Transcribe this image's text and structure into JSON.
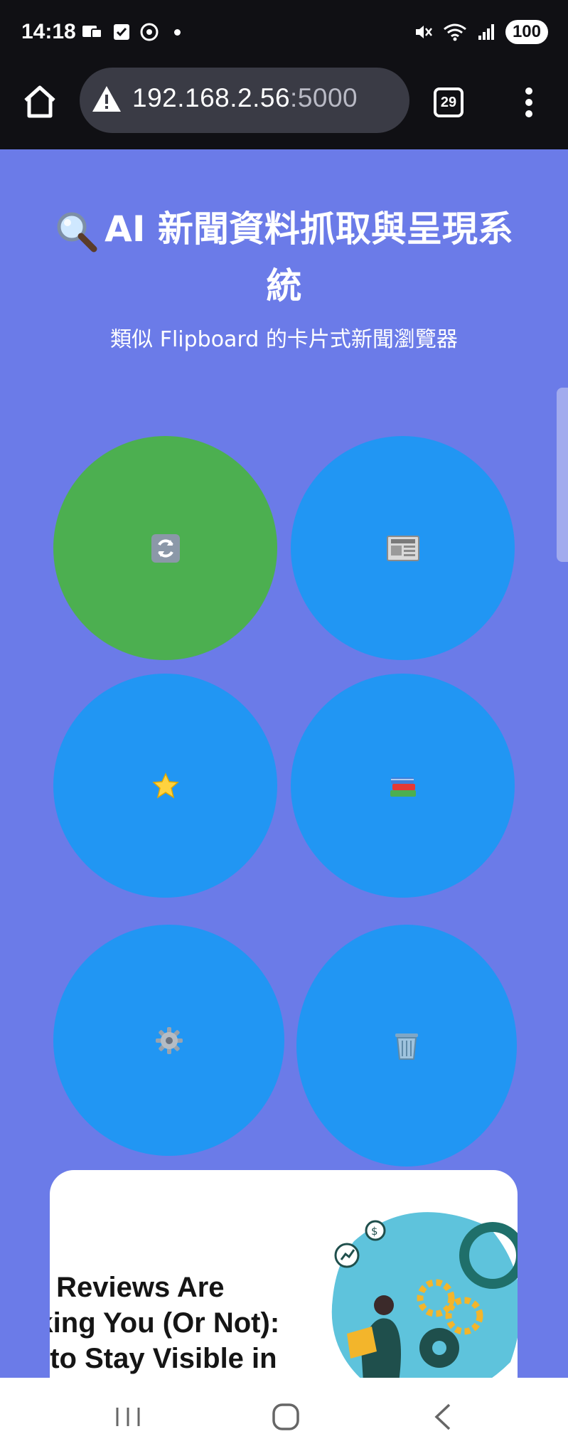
{
  "status_bar": {
    "time": "14:18",
    "battery": "100",
    "left_icons": [
      "message-icon",
      "check-icon",
      "chrome-icon",
      "dot-icon"
    ],
    "right_icons": [
      "mute-icon",
      "wifi-icon",
      "signal-icon"
    ]
  },
  "browser": {
    "url_host": "192.168.2.56",
    "url_port": ":5000",
    "tab_count": "29"
  },
  "page": {
    "title": "AI 新聞資料抓取與呈現系統",
    "title_icon": "magnifier-icon",
    "subtitle": "類似 Flipboard 的卡片式新聞瀏覽器"
  },
  "actions": [
    {
      "name": "refresh-icon",
      "glyph": "🔄",
      "color": "#4caf50"
    },
    {
      "name": "newspaper-icon",
      "glyph": "📰",
      "color": "#2196f3"
    },
    {
      "name": "star-icon",
      "glyph": "⭐",
      "color": "#2196f3"
    },
    {
      "name": "books-icon",
      "glyph": "📚",
      "color": "#2196f3"
    },
    {
      "name": "gear-icon",
      "glyph": "⚙",
      "color": "#2196f3"
    },
    {
      "name": "trash-icon",
      "glyph": "🗑",
      "color": "#2196f3"
    }
  ],
  "card": {
    "headline_line1": "ur Reviews Are",
    "headline_line2": "nking You (Or Not):",
    "headline_line3": "w to Stay Visible in"
  },
  "colors": {
    "background": "#6b7be8",
    "accent_green": "#4caf50",
    "accent_blue": "#2196f3"
  }
}
